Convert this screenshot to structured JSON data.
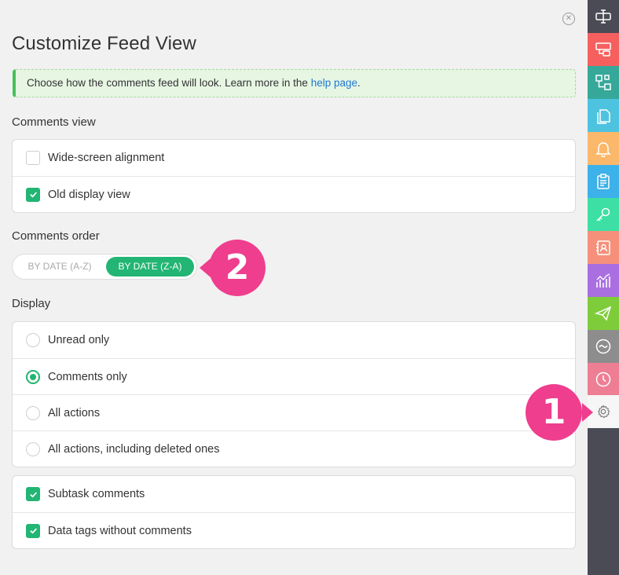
{
  "panel": {
    "title": "Customize Feed View",
    "info_text": "Choose how the comments feed will look. Learn more in the ",
    "info_link": "help page",
    "info_suffix": "."
  },
  "comments_view": {
    "label": "Comments view",
    "options": [
      {
        "label": "Wide-screen alignment",
        "checked": false
      },
      {
        "label": "Old display view",
        "checked": true
      }
    ]
  },
  "comments_order": {
    "label": "Comments order",
    "options": [
      "BY DATE (A-Z)",
      "BY DATE (Z-A)"
    ],
    "selected": "BY DATE (Z-A)"
  },
  "display": {
    "label": "Display",
    "options": [
      {
        "label": "Unread only",
        "selected": false
      },
      {
        "label": "Comments only",
        "selected": true
      },
      {
        "label": "All actions",
        "selected": false
      },
      {
        "label": "All actions, including deleted ones",
        "selected": false
      }
    ],
    "extras": [
      {
        "label": "Subtask comments",
        "checked": true
      },
      {
        "label": "Data tags without comments",
        "checked": true
      }
    ]
  },
  "badges": {
    "one": "1",
    "two": "2"
  },
  "colors": {
    "accent": "#22b573",
    "badge": "#ef3e8e",
    "sidebar": [
      "#4a4b55",
      "#f5605f",
      "#36a89a",
      "#4ec3e0",
      "#fbb86a",
      "#3db1e9",
      "#3ddfa5",
      "#f6907b",
      "#a96fe0",
      "#7fcc3a",
      "#8d8d8d",
      "#ee7e93"
    ]
  },
  "sidebar": {
    "icons": [
      "textfield-icon",
      "task-card-icon",
      "workflow-icon",
      "documents-icon",
      "notification-bell-icon",
      "clipboard-icon",
      "key-icon",
      "contact-icon",
      "analytics-chart-icon",
      "send-plane-icon",
      "activity-icon",
      "history-clock-icon",
      "settings-gear-icon"
    ]
  }
}
